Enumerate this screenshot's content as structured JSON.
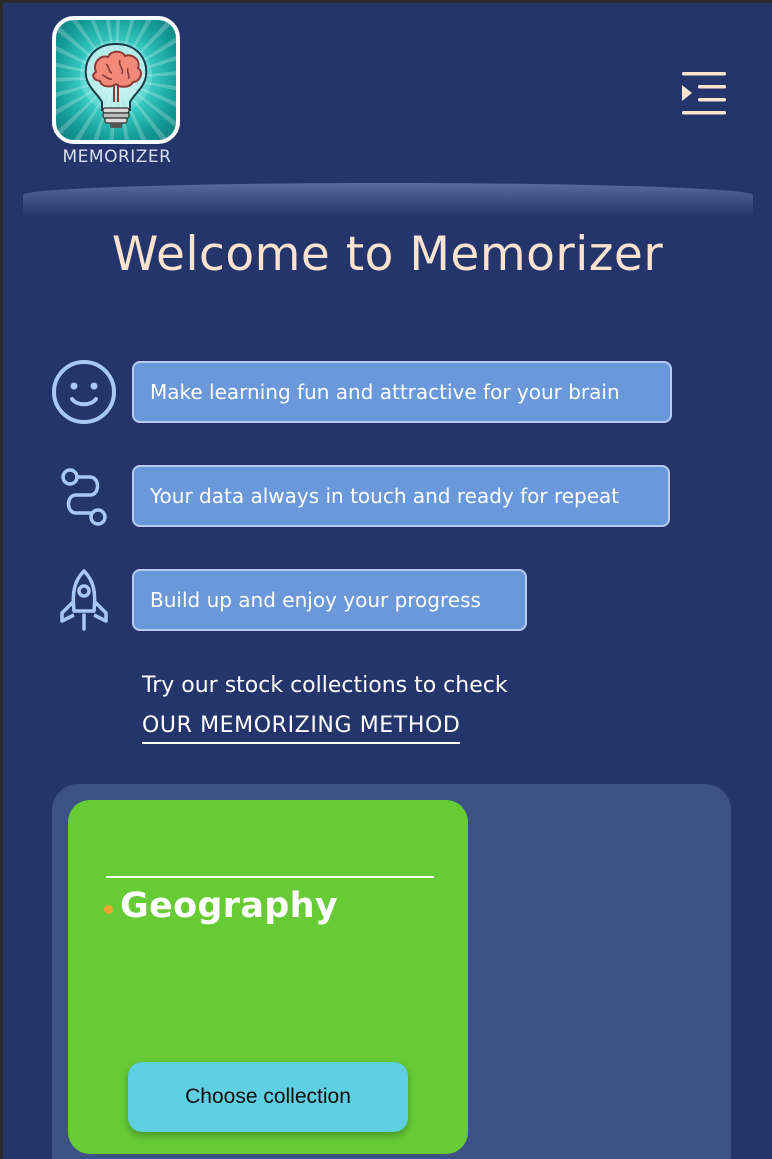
{
  "brand": {
    "name": "MEMORIZER",
    "logo_icon": "brain-lightbulb-logo"
  },
  "header": {
    "menu_icon": "menu-indent-icon"
  },
  "hero": {
    "title": "Welcome to Memorizer"
  },
  "features": [
    {
      "icon": "smiley-face-icon",
      "text": "Make learning fun and attractive for your brain"
    },
    {
      "icon": "route-path-icon",
      "text": "Your data always in touch and ready for repeat"
    },
    {
      "icon": "rocket-icon",
      "text": "Build up and enjoy your progress"
    }
  ],
  "cta": {
    "intro": "Try our stock collections to check",
    "link": "OUR MEMORIZING METHOD"
  },
  "collections": [
    {
      "title": "Geography",
      "button": "Choose collection",
      "color": "#67cb36"
    }
  ],
  "colors": {
    "background": "#24356c",
    "title": "#fbe3cf",
    "pill": "#6a98db",
    "icon": "#a9c8f5",
    "button": "#5fcfe2",
    "card": "#67cb36",
    "panel": "#3e5185",
    "dot": "#f2a531"
  }
}
